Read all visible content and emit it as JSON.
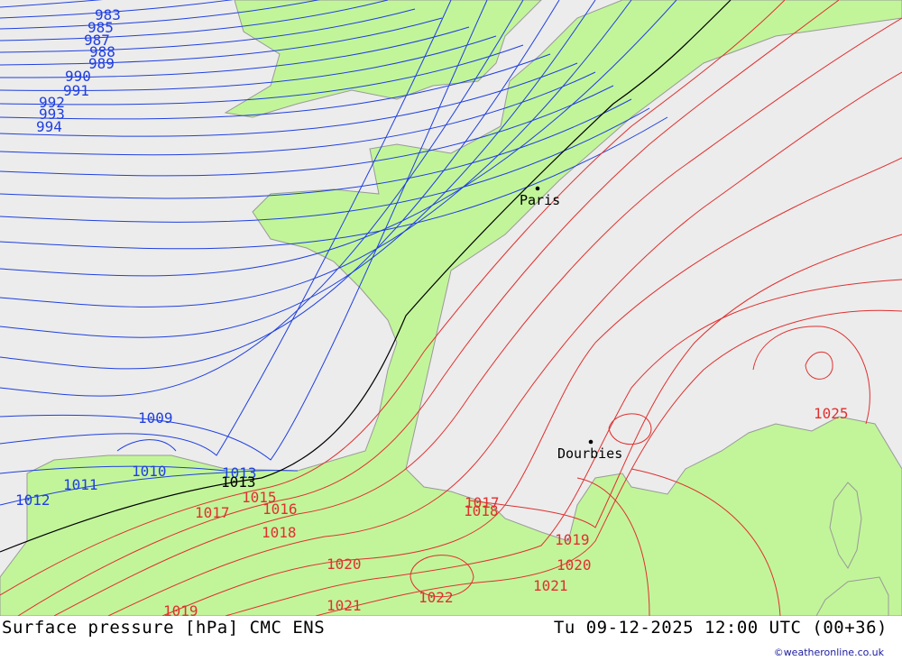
{
  "map": {
    "title": "Surface pressure [hPa] CMC ENS",
    "valid_time": "Tu 09-12-2025 12:00 UTC (00+36)",
    "credit": "©weatheronline.co.uk",
    "unit": "hPa",
    "colors": {
      "sea": "#ececec",
      "land": "#c2f59a",
      "coastline": "#999999",
      "low_isobar": "#1f3fe0",
      "high_isobar": "#e03030",
      "reference_isobar": "#000000"
    },
    "cities": [
      {
        "name": "Paris",
        "icon": "city-dot-icon"
      },
      {
        "name": "Dourbies",
        "icon": "city-dot-icon"
      }
    ],
    "isobar_labels": {
      "low": [
        "983",
        "985",
        "987",
        "988",
        "989",
        "990",
        "991",
        "992",
        "993",
        "994",
        "1009",
        "1010",
        "1011",
        "1012",
        "1013"
      ],
      "reference": [
        "1013"
      ],
      "high": [
        "1015",
        "1016",
        "1017",
        "1017",
        "1018",
        "1018",
        "1019",
        "1019",
        "1020",
        "1020",
        "1021",
        "1021",
        "1022",
        "1025"
      ]
    }
  }
}
